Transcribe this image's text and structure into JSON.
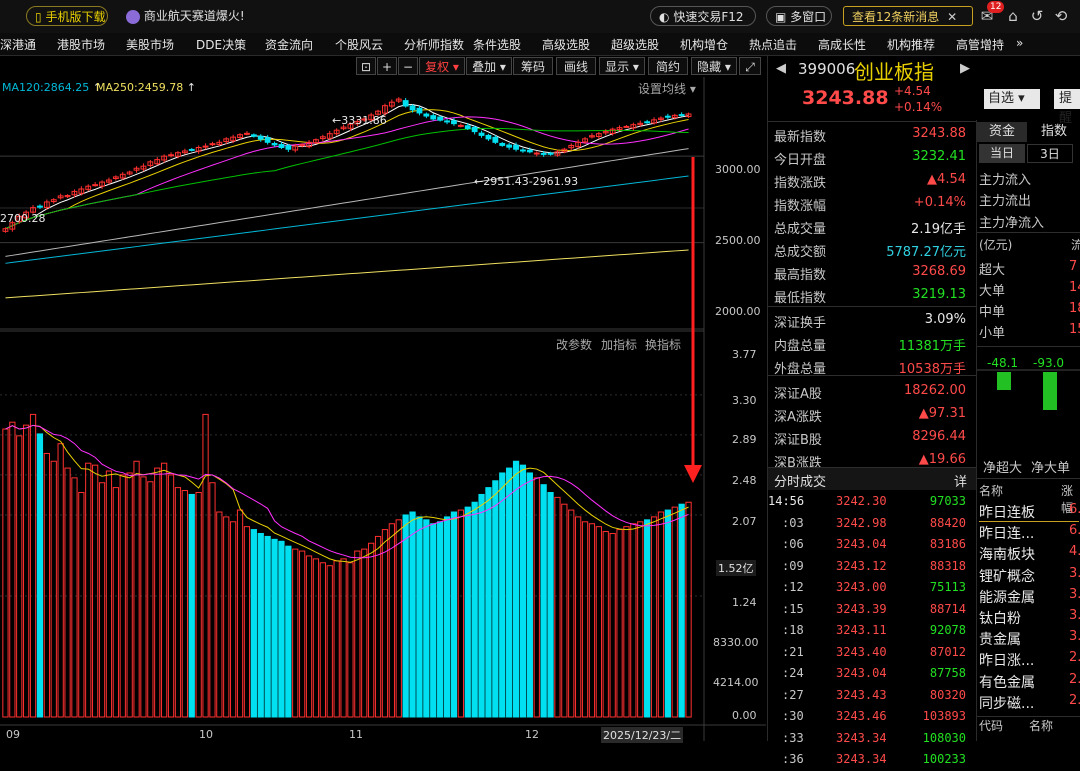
{
  "topbar": {
    "mobile_label": "手机版下载",
    "promo_label": "商业航天赛道爆火!",
    "quick_trade_label": "快速交易F12",
    "multi_window_label": "多窗口",
    "messages_label": "查看12条新消息",
    "mail_badge": "12"
  },
  "nav": {
    "items": [
      "深港通",
      "港股市场",
      "美股市场",
      "DDE决策",
      "资金流向",
      "个股风云",
      "分析师指数",
      "条件选股",
      "高级选股",
      "超级选股",
      "机构增仓",
      "热点追击",
      "高成长性",
      "机构推荐",
      "高管增持"
    ],
    "more_label": "»"
  },
  "toolbar": {
    "buttons": [
      "复权",
      "叠加",
      "筹码",
      "画线",
      "显示",
      "简约",
      "隐藏"
    ],
    "settings_label": "设置均线"
  },
  "chart": {
    "ma120_label": "MA120:2864.25",
    "ma250_label": "MA250:2459.78",
    "high_annotation": "3331.86",
    "low_annotation": "2951.43-2961.93",
    "left_annotation": "2700.28",
    "price_axis": [
      "3000.00",
      "2500.00",
      "2000.00"
    ],
    "volume_axis": [
      "3.77",
      "3.30",
      "2.89",
      "2.48",
      "2.07",
      "1.52亿",
      "1.24",
      "8330.00",
      "4214.00",
      "0.00"
    ],
    "volume_menu": [
      "改参数",
      "加指标",
      "换指标"
    ],
    "date_labels": [
      "09",
      "10",
      "11",
      "12"
    ],
    "cursor_date": "2025/12/23/二",
    "colors": {
      "up": "#ff3030",
      "down": "#00e0f0",
      "ma5": "#ffffff",
      "ma10": "#e8d000",
      "ma20": "#ff30ff",
      "ma60": "#00c000",
      "ma120": "#00b8d8",
      "ma250": "#f0e060"
    }
  },
  "chart_data": {
    "type": "candlestick",
    "title": "",
    "ylim": [
      2000,
      3400
    ],
    "volume_ylim": [
      0,
      3.77
    ],
    "volume_unit": "亿",
    "price_close": [
      2580,
      2615,
      2652,
      2676,
      2702,
      2710,
      2735,
      2748,
      2770,
      2772,
      2796,
      2810,
      2826,
      2835,
      2850,
      2862,
      2880,
      2895,
      2908,
      2930,
      2942,
      2967,
      2980,
      3000,
      3008,
      3020,
      3030,
      3035,
      3050,
      3058,
      3072,
      3080,
      3100,
      3110,
      3124,
      3132,
      3115,
      3098,
      3080,
      3065,
      3050,
      3040,
      3058,
      3066,
      3080,
      3095,
      3112,
      3130,
      3150,
      3168,
      3185,
      3200,
      3215,
      3238,
      3260,
      3292,
      3312,
      3330,
      3290,
      3268,
      3250,
      3232,
      3215,
      3208,
      3200,
      3188,
      3178,
      3160,
      3142,
      3120,
      3100,
      3080,
      3062,
      3052,
      3040,
      3030,
      3025,
      3018,
      3010,
      3015,
      3025,
      3040,
      3062,
      3080,
      3100,
      3118,
      3130,
      3142,
      3156,
      3165,
      3172,
      3182,
      3190,
      3198,
      3210,
      3220,
      3228,
      3236,
      3240,
      3243.88
    ],
    "volume": [
      2.95,
      3.02,
      2.88,
      2.99,
      3.1,
      2.9,
      2.7,
      2.62,
      2.8,
      2.55,
      2.45,
      2.3,
      2.6,
      2.58,
      2.4,
      2.52,
      2.35,
      2.48,
      2.5,
      2.62,
      2.46,
      2.41,
      2.55,
      2.6,
      2.48,
      2.35,
      2.32,
      2.28,
      2.3,
      3.1,
      2.4,
      2.1,
      2.05,
      2.0,
      2.12,
      1.95,
      1.92,
      1.88,
      1.85,
      1.82,
      1.8,
      1.75,
      1.72,
      1.7,
      1.65,
      1.62,
      1.58,
      1.55,
      1.6,
      1.62,
      1.58,
      1.7,
      1.72,
      1.78,
      1.85,
      1.92,
      1.98,
      2.02,
      2.07,
      2.1,
      2.05,
      2.02,
      1.98,
      2.0,
      2.05,
      2.1,
      2.12,
      2.15,
      2.2,
      2.28,
      2.35,
      2.42,
      2.5,
      2.55,
      2.62,
      2.58,
      2.5,
      2.45,
      2.38,
      2.3,
      2.25,
      2.18,
      2.12,
      2.05,
      2.0,
      1.98,
      1.95,
      1.9,
      1.88,
      1.92,
      1.95,
      1.98,
      2.0,
      2.02,
      2.05,
      2.1,
      2.12,
      2.15,
      2.18,
      2.2
    ]
  },
  "quote": {
    "code": "399006",
    "name": "创业板指",
    "price": "3243.88",
    "change": "+4.54",
    "change_pct": "+0.14%",
    "watchlist_label": "自选",
    "remind_label": "提醒"
  },
  "stats": [
    {
      "label": "最新指数",
      "value": "3243.88",
      "color": "red"
    },
    {
      "label": "今日开盘",
      "value": "3232.41",
      "color": "green"
    },
    {
      "label": "指数涨跌",
      "value": "▲4.54",
      "color": "red"
    },
    {
      "label": "指数涨幅",
      "value": "+0.14%",
      "color": "red"
    },
    {
      "label": "总成交量",
      "value": "2.19亿手",
      "color": "white"
    },
    {
      "label": "总成交额",
      "value": "5787.27亿元",
      "color": "cyan"
    },
    {
      "label": "最高指数",
      "value": "3268.69",
      "color": "red"
    },
    {
      "label": "最低指数",
      "value": "3219.13",
      "color": "green"
    },
    {
      "label": "深证换手",
      "value": "3.09%",
      "color": "white"
    },
    {
      "label": "内盘总量",
      "value": "11381万手",
      "color": "green"
    },
    {
      "label": "外盘总量",
      "value": "10538万手",
      "color": "red"
    },
    {
      "label": "深证A股",
      "value": "18262.00",
      "color": "red"
    },
    {
      "label": "深A涨跌",
      "value": "▲97.31",
      "color": "red"
    },
    {
      "label": "深证B股",
      "value": "8296.44",
      "color": "red"
    },
    {
      "label": "深B涨跌",
      "value": "▲19.66",
      "color": "red"
    }
  ],
  "ticks_header": {
    "title": "分时成交",
    "detail": "详"
  },
  "ticks": [
    {
      "t": "14:56",
      "p": "3242.30",
      "q": "97033",
      "c": "green"
    },
    {
      "t": ":03",
      "p": "3242.98",
      "q": "88420",
      "c": "red"
    },
    {
      "t": ":06",
      "p": "3243.04",
      "q": "83186",
      "c": "red"
    },
    {
      "t": ":09",
      "p": "3243.12",
      "q": "88318",
      "c": "red"
    },
    {
      "t": ":12",
      "p": "3243.00",
      "q": "75113",
      "c": "green"
    },
    {
      "t": ":15",
      "p": "3243.39",
      "q": "88714",
      "c": "red"
    },
    {
      "t": ":18",
      "p": "3243.11",
      "q": "92078",
      "c": "green"
    },
    {
      "t": ":21",
      "p": "3243.40",
      "q": "87012",
      "c": "red"
    },
    {
      "t": ":24",
      "p": "3243.04",
      "q": "87758",
      "c": "green"
    },
    {
      "t": ":27",
      "p": "3243.43",
      "q": "80320",
      "c": "red"
    },
    {
      "t": ":30",
      "p": "3243.46",
      "q": "103893",
      "c": "red"
    },
    {
      "t": ":33",
      "p": "3243.34",
      "q": "108030",
      "c": "green"
    },
    {
      "t": ":36",
      "p": "3243.34",
      "q": "100233",
      "c": "green"
    }
  ],
  "flow": {
    "tabs": [
      "资金",
      "指数"
    ],
    "period_tabs": [
      "当日",
      "3日"
    ],
    "labels": [
      "主力流入",
      "主力流出",
      "主力净流入"
    ],
    "unit_label": "(亿元)",
    "unit_right": "流",
    "sizes": [
      {
        "label": "超大",
        "value": "7"
      },
      {
        "label": "大单",
        "value": "14"
      },
      {
        "label": "中单",
        "value": "18"
      },
      {
        "label": "小单",
        "value": "15"
      }
    ],
    "bars": [
      {
        "label": "净超大",
        "value": "-48.1"
      },
      {
        "label": "净大单",
        "value": "-93.0"
      }
    ]
  },
  "sectors": {
    "header_name": "名称",
    "header_chg": "涨幅",
    "items": [
      {
        "name": "昨日连板",
        "chg": "6."
      },
      {
        "name": "昨日连...",
        "chg": "6."
      },
      {
        "name": "海南板块",
        "chg": "4."
      },
      {
        "name": "锂矿概念",
        "chg": "3."
      },
      {
        "name": "能源金属",
        "chg": "3."
      },
      {
        "name": "钛白粉",
        "chg": "3."
      },
      {
        "name": "贵金属",
        "chg": "3."
      },
      {
        "name": "昨日涨...",
        "chg": "2."
      },
      {
        "name": "有色金属",
        "chg": "2."
      },
      {
        "name": "同步磁...",
        "chg": "2."
      }
    ],
    "footer_code": "代码",
    "footer_name": "名称"
  }
}
